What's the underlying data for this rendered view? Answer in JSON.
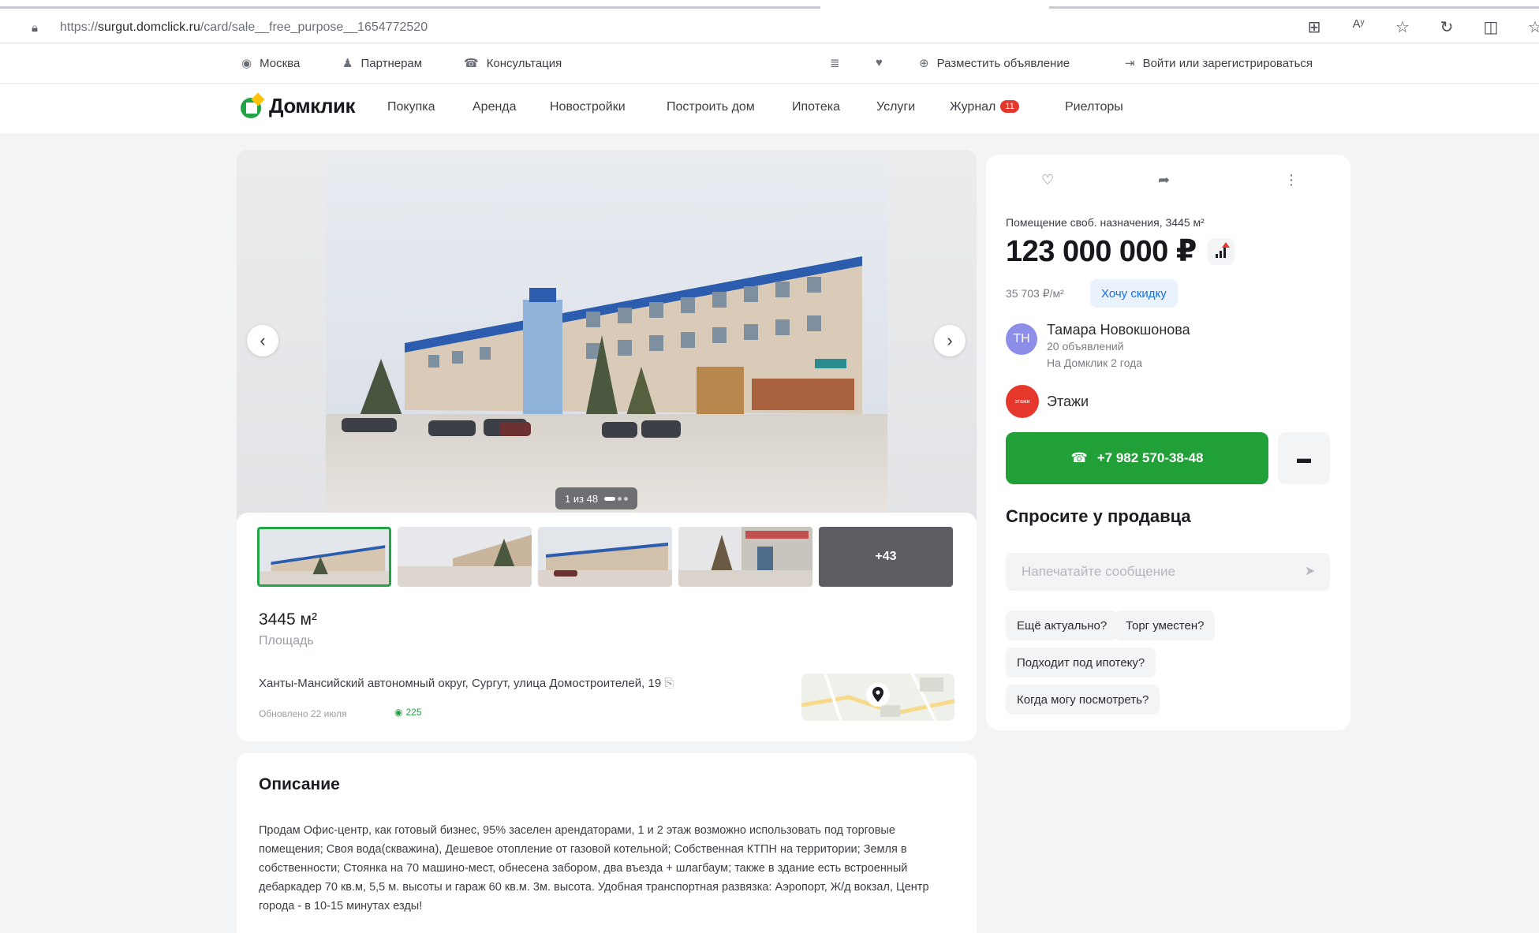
{
  "browser": {
    "url_prefix": "https://",
    "url_domain": "surgut.domclick.ru",
    "url_path": "/card/sale__free_purpose__1654772520"
  },
  "topbar": {
    "city": "Москва",
    "partners": "Партнерам",
    "consult": "Консультация",
    "post_ad": "Разместить объявление",
    "login": "Войти или зарегистрироваться"
  },
  "nav": {
    "logo": "Домклик",
    "items": [
      "Покупка",
      "Аренда",
      "Новостройки",
      "Построить дом",
      "Ипотека",
      "Услуги",
      "Журнал",
      "Риелторы"
    ],
    "journal_badge": "11"
  },
  "gallery": {
    "counter": "1 из 48",
    "more_label": "+43"
  },
  "listing": {
    "area_value": "3445 м²",
    "area_label": "Площадь",
    "address": "Ханты-Мансийский автономный округ, Сургут, улица Домостроителей, 19",
    "updated": "Обновлено 22 июля",
    "views": "225"
  },
  "description": {
    "title": "Описание",
    "text": "Продам Офис-центр, как готовый бизнес, 95% заселен арендаторами, 1 и 2 этаж возможно использовать под торговые помещения; Своя вода(скважина), Дешевое отопление от газовой котельной; Собственная КТПН на территории; Земля в собственности; Стоянка на 70 машино-мест, обнесена забором, два въезда + шлагбаум; также в здание есть встроенный дебаркадер 70 кв.м, 5,5 м. высоты и гараж 60 кв.м. 3м. высота. Удобная транспортная развязка: Аэропорт, Ж/д вокзал, Центр города - в 10-15 минутах езды!"
  },
  "side": {
    "type": "Помещение своб. назначения, 3445 м²",
    "price": "123 000 000 ₽",
    "price_per_m2": "35 703 ₽/м²",
    "discount_btn": "Хочу скидку",
    "agent_initials": "ТН",
    "agent_name": "Тамара Новокшонова",
    "agent_ads": "20 объявлений",
    "agent_since": "На Домклик 2 года",
    "agency_logo_text": "этажи",
    "agency_name": "Этажи",
    "phone": "+7 982 570-38-48",
    "ask_title": "Спросите у продавца",
    "msg_placeholder": "Напечатайте сообщение",
    "chips": [
      "Ещё актуально?",
      "Торг уместен?",
      "Подходит под ипотеку?",
      "Когда могу посмотреть?"
    ]
  },
  "colors": {
    "brand_green": "#21a038",
    "accent_blue": "#1b6fd8",
    "badge_red": "#e5372c"
  }
}
